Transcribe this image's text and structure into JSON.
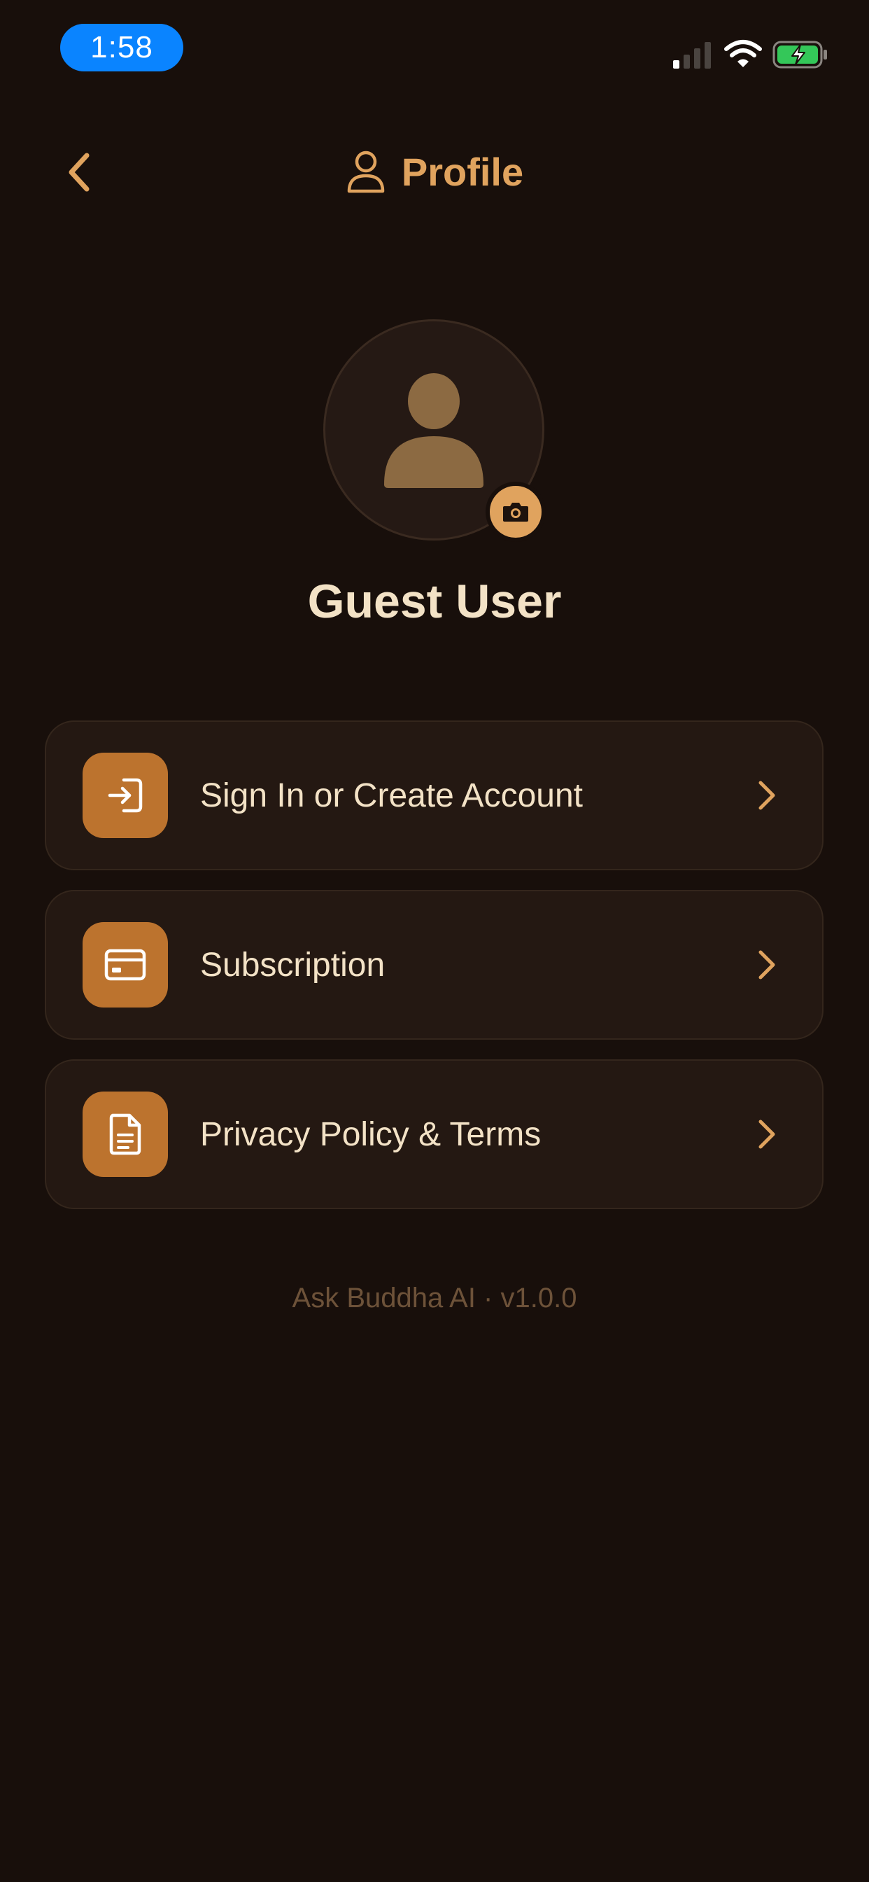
{
  "status_bar": {
    "time": "1:58",
    "icons": [
      "signal-icon",
      "wifi-icon",
      "battery-charging-icon"
    ]
  },
  "header": {
    "title": "Profile",
    "back_icon": "chevron-left-icon",
    "title_icon": "person-outline-icon"
  },
  "profile": {
    "name": "Guest User",
    "avatar_icon": "person-silhouette-icon",
    "edit_photo_icon": "camera-icon"
  },
  "menu": {
    "items": [
      {
        "label": "Sign In or Create Account",
        "icon": "sign-in-icon"
      },
      {
        "label": "Subscription",
        "icon": "credit-card-icon"
      },
      {
        "label": "Privacy Policy & Terms",
        "icon": "document-icon"
      }
    ]
  },
  "footer": {
    "version_text": "Ask Buddha AI · v1.0.0"
  },
  "colors": {
    "background": "#180f0b",
    "accent": "#e0a35e",
    "card": "#241812",
    "icon_tile": "#bc732e",
    "text": "#f3e2c6",
    "muted_text": "#6d5239",
    "time_pill": "#0a84ff",
    "battery": "#34c759"
  }
}
